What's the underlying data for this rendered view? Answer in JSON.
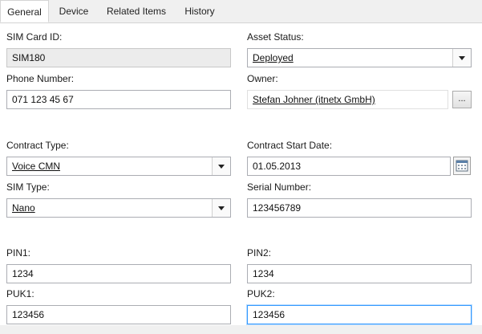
{
  "tabs": [
    {
      "label": "General"
    },
    {
      "label": "Device"
    },
    {
      "label": "Related Items"
    },
    {
      "label": "History"
    }
  ],
  "form": {
    "sim_card_id": {
      "label": "SIM Card ID:",
      "value": "SIM180"
    },
    "asset_status": {
      "label": "Asset Status:",
      "value": "Deployed"
    },
    "phone_number": {
      "label": "Phone Number:",
      "value": "071 123 45 67"
    },
    "owner": {
      "label": "Owner:",
      "value": "Stefan Johner (itnetx GmbH)",
      "browse_label": "..."
    },
    "contract_type": {
      "label": "Contract Type:",
      "value": "Voice CMN"
    },
    "contract_start_date": {
      "label": "Contract Start Date:",
      "value": "01.05.2013"
    },
    "sim_type": {
      "label": "SIM Type:",
      "value": "Nano"
    },
    "serial_number": {
      "label": "Serial Number:",
      "value": "123456789"
    },
    "pin1": {
      "label": "PIN1:",
      "value": "1234"
    },
    "pin2": {
      "label": "PIN2:",
      "value": "1234"
    },
    "puk1": {
      "label": "PUK1:",
      "value": "123456"
    },
    "puk2": {
      "label": "PUK2:",
      "value": "123456"
    }
  },
  "icons": {
    "calendar": "calendar-icon",
    "dropdown": "chevron-down-icon"
  },
  "colors": {
    "focus_border": "#3399ff",
    "readonly_bg": "#ececec"
  }
}
